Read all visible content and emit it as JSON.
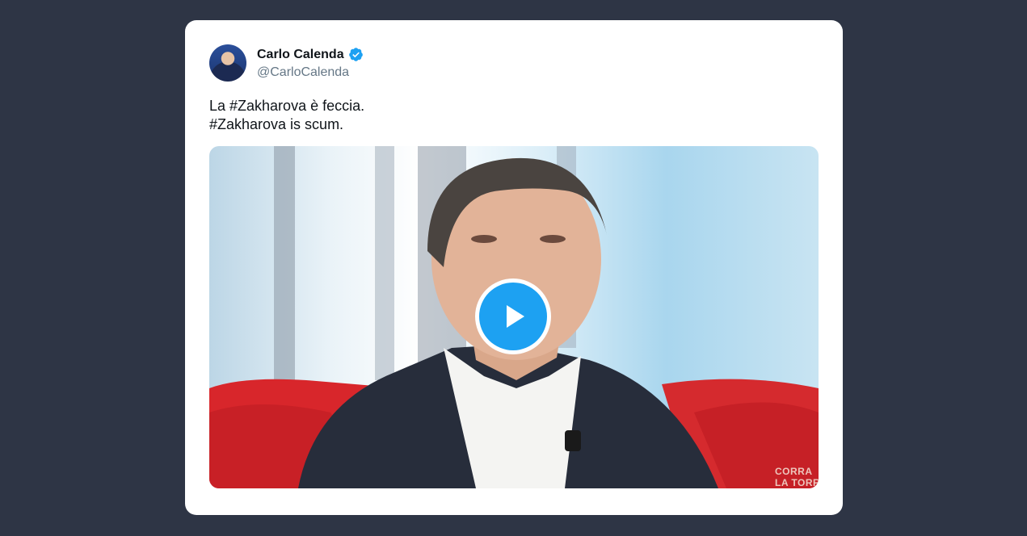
{
  "tweet": {
    "author_name": "Carlo Calenda",
    "author_handle": "@CarloCalenda",
    "verified": true,
    "text_lines": [
      "La #Zakharova è feccia.",
      "#Zakharova is scum."
    ]
  },
  "media": {
    "type": "video",
    "overlay_lines": [
      "CORRA",
      "LA TORR"
    ]
  },
  "colors": {
    "background": "#2e3545",
    "card": "#ffffff",
    "accent": "#1da1f2",
    "handle": "#657786"
  },
  "icons": [
    "verified-badge-icon",
    "play-icon"
  ]
}
